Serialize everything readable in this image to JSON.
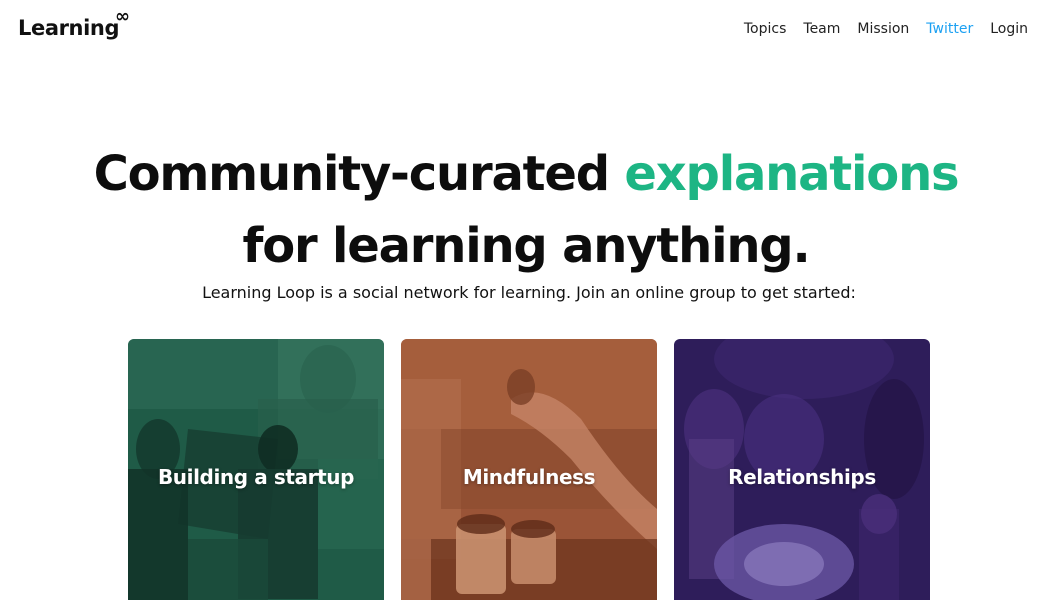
{
  "header": {
    "logo": "Learning",
    "logo_mark": "∞",
    "nav": {
      "topics": "Topics",
      "team": "Team",
      "mission": "Mission",
      "twitter": "Twitter",
      "login": "Login"
    }
  },
  "hero": {
    "title_part1": "Community-curated ",
    "title_accent": "explanations",
    "title_part2": "for learning anything.",
    "subtitle": "Learning Loop is a social network for learning. Join an online group to get started:"
  },
  "groups": [
    {
      "label": "Building a startup",
      "color": "#1f5b47"
    },
    {
      "label": "Mindfulness",
      "color": "#9a5437"
    },
    {
      "label": "Relationships",
      "color": "#2e1d5a"
    }
  ],
  "colors": {
    "accent": "#1db584",
    "twitter": "#1da1f2"
  }
}
